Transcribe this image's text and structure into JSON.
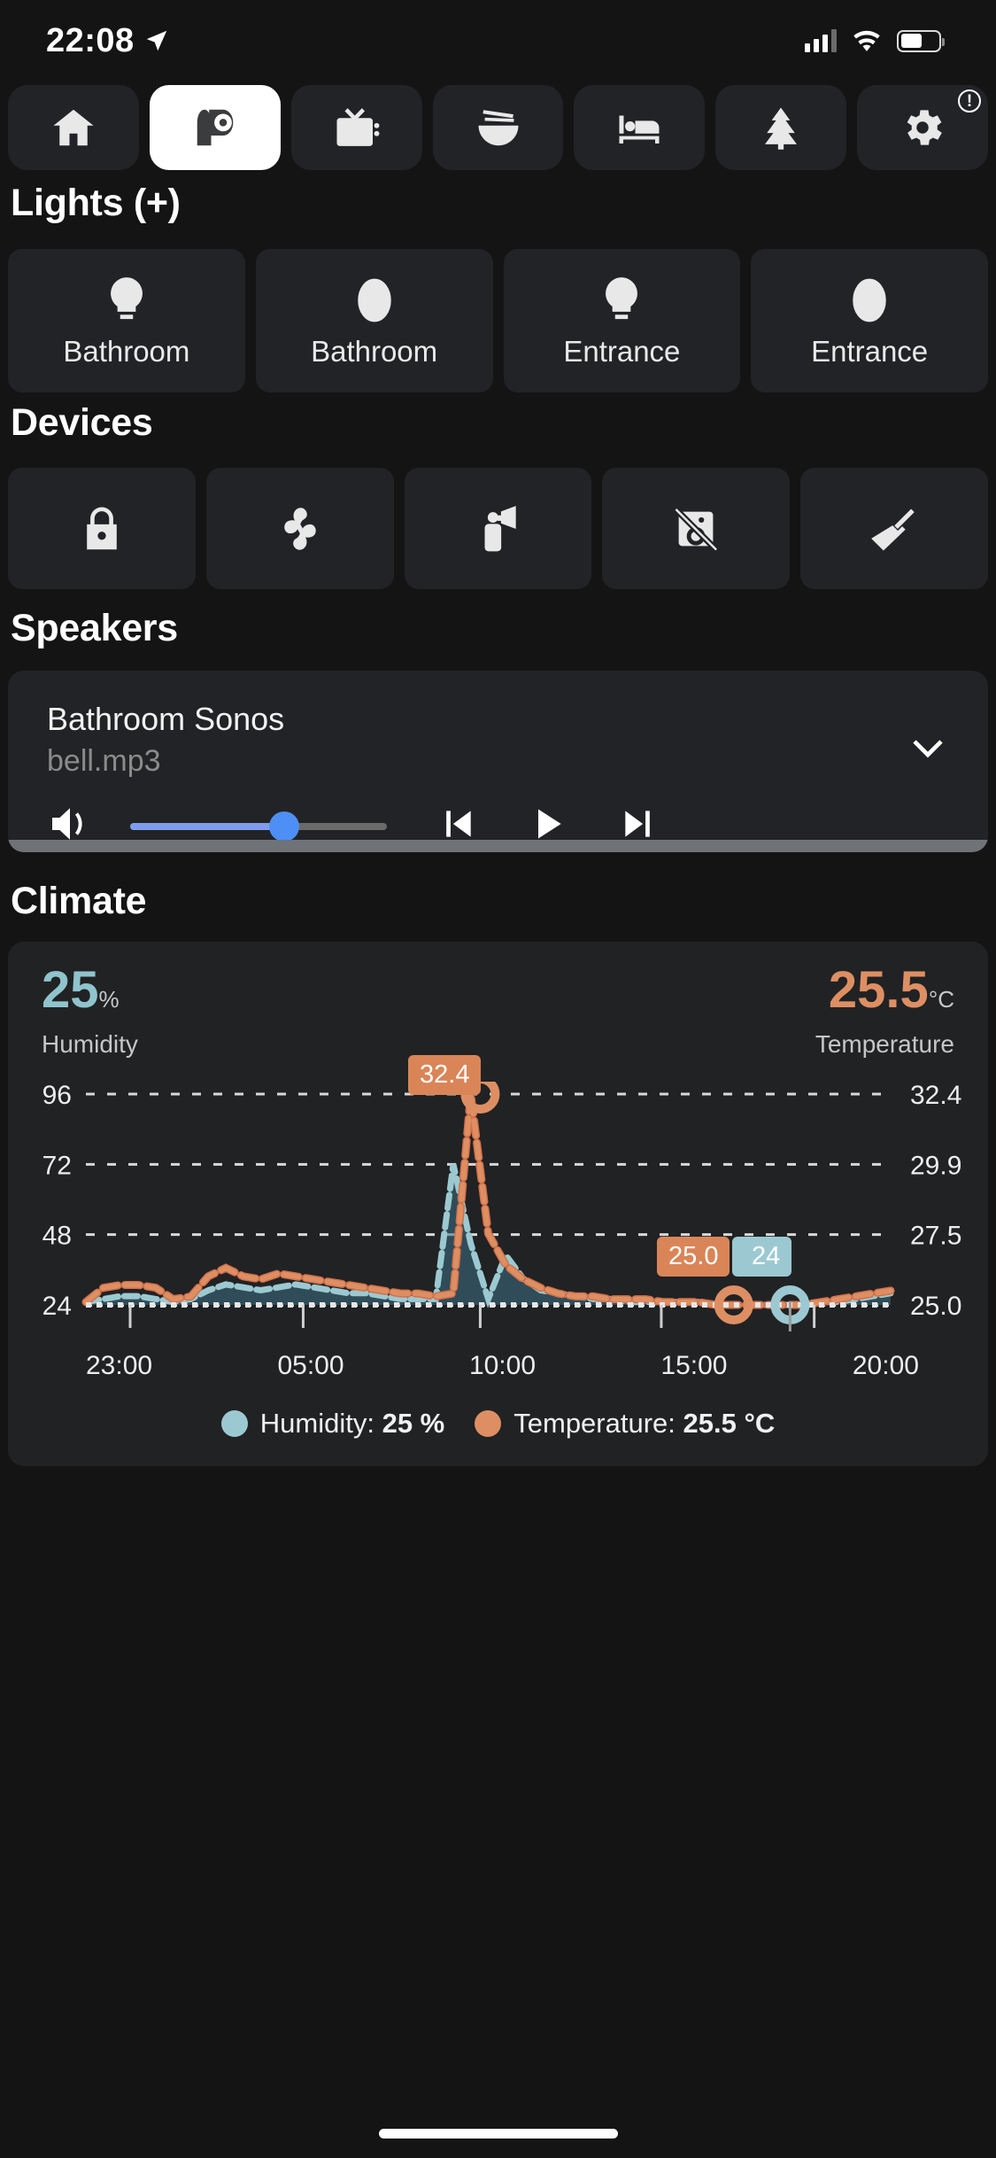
{
  "status_bar": {
    "time": "22:08",
    "location_icon": "location-arrow-icon",
    "cellular_icon": "cellular-signal-icon",
    "wifi_icon": "wifi-icon",
    "battery_icon": "battery-icon"
  },
  "tabs": [
    {
      "name": "home",
      "icon": "home-icon",
      "active": false,
      "badge": ""
    },
    {
      "name": "toilet",
      "icon": "toilet-paper-icon",
      "active": true,
      "badge": ""
    },
    {
      "name": "tv",
      "icon": "tv-icon",
      "active": false,
      "badge": ""
    },
    {
      "name": "kitchen",
      "icon": "noodle-bowl-icon",
      "active": false,
      "badge": ""
    },
    {
      "name": "bedroom",
      "icon": "bed-icon",
      "active": false,
      "badge": ""
    },
    {
      "name": "outdoor",
      "icon": "tree-icon",
      "active": false,
      "badge": ""
    },
    {
      "name": "settings",
      "icon": "gear-icon",
      "active": false,
      "badge": "!"
    }
  ],
  "sections": {
    "lights_title": "Lights (+)",
    "devices_title": "Devices",
    "speakers_title": "Speakers",
    "climate_title": "Climate"
  },
  "lights": [
    {
      "label": "Bathroom",
      "icon": "lightbulb-icon"
    },
    {
      "label": "Bathroom",
      "icon": "mirror-light-icon"
    },
    {
      "label": "Entrance",
      "icon": "lightbulb-icon"
    },
    {
      "label": "Entrance",
      "icon": "mirror-light-icon"
    }
  ],
  "devices": [
    {
      "name": "lock",
      "icon": "lock-icon"
    },
    {
      "name": "fan",
      "icon": "fan-icon"
    },
    {
      "name": "siren",
      "icon": "air-horn-icon"
    },
    {
      "name": "motion-sensor",
      "icon": "motion-sensor-off-icon"
    },
    {
      "name": "vacuum",
      "icon": "broom-icon"
    }
  ],
  "speaker": {
    "name": "Bathroom Sonos",
    "media": "bell.mp3",
    "volume_percent": 60,
    "collapse_icon": "chevron-down-icon",
    "volume_icon": "speaker-volume-icon",
    "prev_icon": "skip-previous-icon",
    "play_icon": "play-icon",
    "next_icon": "skip-next-icon"
  },
  "climate": {
    "humidity_value": "25",
    "humidity_unit": "%",
    "humidity_label": "Humidity",
    "humidity_color": "#8fc4cd",
    "temperature_value": "25.5",
    "temperature_unit": "°C",
    "temperature_label": "Temperature",
    "temperature_color": "#dd8f63",
    "peak_badge": "32.4",
    "last_temp_badge": "25.0",
    "last_hum_badge": "24",
    "legend": [
      {
        "name": "humidity",
        "label": "Humidity:",
        "value": "25 %",
        "color": "#9cc9d1"
      },
      {
        "name": "temperature",
        "label": "Temperature:",
        "value": "25.5 °C",
        "color": "#dd8f63"
      }
    ]
  },
  "chart_data": {
    "type": "line",
    "title": "",
    "xlabel": "",
    "ylabel": "",
    "grid": true,
    "legend_position": "bottom",
    "x_ticks": [
      "23:00",
      "05:00",
      "10:00",
      "15:00",
      "20:00"
    ],
    "y_left_ticks": [
      96,
      72,
      48,
      24
    ],
    "y_right_ticks": [
      "32.4",
      "29.9",
      "27.5",
      "25.0"
    ],
    "ylim_left": [
      24,
      96
    ],
    "ylim_right": [
      25.0,
      32.4
    ],
    "series": [
      {
        "name": "Humidity",
        "axis": "left",
        "color": "#9cc9d1",
        "unit": "%",
        "current": 25,
        "values": [
          25,
          26,
          27,
          27,
          26,
          25,
          26,
          29,
          31,
          30,
          29,
          30,
          31,
          30,
          29,
          28,
          28,
          27,
          26,
          26,
          26,
          72,
          45,
          26,
          41,
          33,
          29,
          28,
          27,
          26,
          26,
          25,
          25,
          25,
          25,
          25,
          24,
          24,
          24,
          24,
          24,
          24,
          25,
          25,
          26,
          27,
          28
        ]
      },
      {
        "name": "Temperature",
        "axis": "right",
        "color": "#dd8f63",
        "unit": "°C",
        "current": 25.5,
        "peak": 32.4,
        "values": [
          25.1,
          25.6,
          25.7,
          25.7,
          25.6,
          25.2,
          25.3,
          26.0,
          26.3,
          26.0,
          25.9,
          26.1,
          26.0,
          25.9,
          25.8,
          25.7,
          25.6,
          25.5,
          25.4,
          25.4,
          25.3,
          25.4,
          32.4,
          27.5,
          26.4,
          25.9,
          25.6,
          25.4,
          25.3,
          25.3,
          25.2,
          25.2,
          25.2,
          25.1,
          25.1,
          25.1,
          25.0,
          25.0,
          25.0,
          25.0,
          25.0,
          25.0,
          25.1,
          25.2,
          25.3,
          25.4,
          25.5
        ]
      }
    ],
    "markers": [
      {
        "series": "Temperature",
        "x": "10:00",
        "value": "32.4"
      },
      {
        "series": "Temperature",
        "x": "20:00",
        "value": "25.0"
      },
      {
        "series": "Humidity",
        "x": "21:00",
        "value": "24"
      }
    ]
  }
}
